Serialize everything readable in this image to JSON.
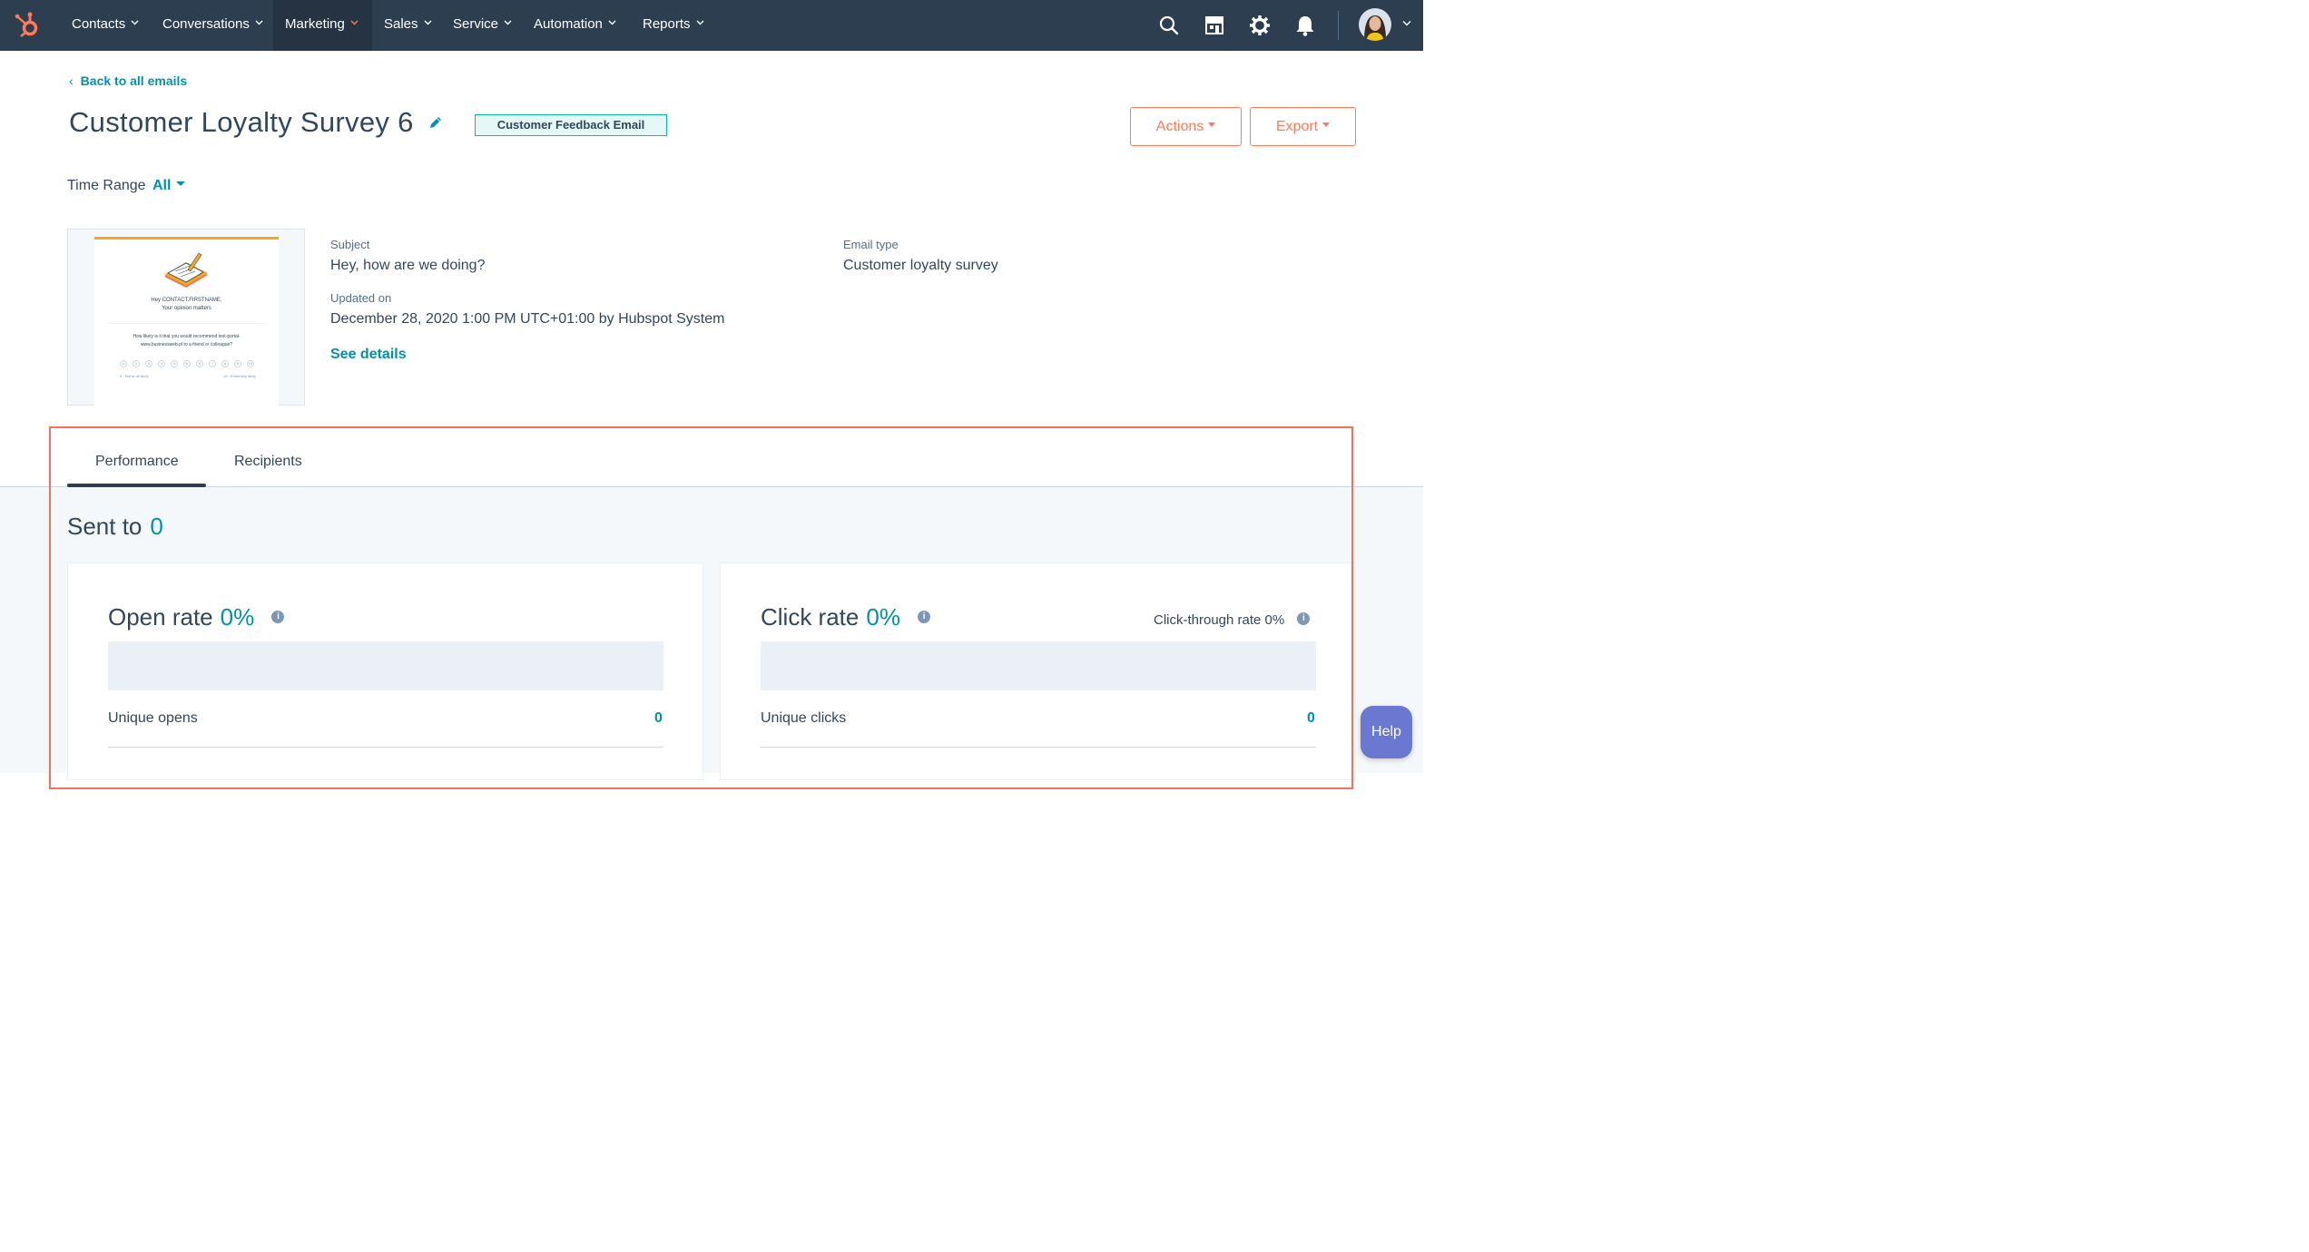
{
  "nav": {
    "items": [
      {
        "label": "Contacts"
      },
      {
        "label": "Conversations"
      },
      {
        "label": "Marketing",
        "active": true
      },
      {
        "label": "Sales"
      },
      {
        "label": "Service"
      },
      {
        "label": "Automation"
      },
      {
        "label": "Reports"
      }
    ],
    "icons": [
      "search-icon",
      "marketplace-icon",
      "gear-icon",
      "bell-icon"
    ]
  },
  "header": {
    "back_label": "Back to all emails",
    "title": "Customer Loyalty Survey 6",
    "tag": "Customer Feedback Email",
    "actions_label": "Actions",
    "export_label": "Export"
  },
  "time_range": {
    "label": "Time Range",
    "value": "All"
  },
  "preview": {
    "greeting": "Hey CONTACT.FIRSTNAME,",
    "tagline": "Your opinion matters",
    "question_line1": "How likely is it that you would recommend test-portal-",
    "question_line2": "www.businessweb.pl to a friend or colleague?",
    "scale": [
      "0",
      "1",
      "2",
      "3",
      "4",
      "5",
      "6",
      "7",
      "8",
      "9",
      "10"
    ],
    "low_label": "0 - Not at all likely",
    "high_label": "10 - Extremely likely"
  },
  "meta": {
    "subject_label": "Subject",
    "subject_value": "Hey, how are we doing?",
    "updated_label": "Updated on",
    "updated_value": "December 28, 2020 1:00 PM UTC+01:00 by Hubspot System",
    "email_type_label": "Email type",
    "email_type_value": "Customer loyalty survey",
    "see_details": "See details"
  },
  "tabs": [
    {
      "label": "Performance",
      "active": true
    },
    {
      "label": "Recipients"
    }
  ],
  "sent_to": {
    "label": "Sent to",
    "value": "0"
  },
  "open_card": {
    "title": "Open rate",
    "rate": "0%",
    "row_label": "Unique opens",
    "row_value": "0"
  },
  "click_card": {
    "title": "Click rate",
    "rate": "0%",
    "ctr_label": "Click-through rate 0%",
    "row_label": "Unique clicks",
    "row_value": "0"
  },
  "help_label": "Help",
  "colors": {
    "nav_bg": "#2d3e50",
    "accent_orange": "#ff7a59",
    "link_blue": "#0091ae",
    "badge_teal": "#00bda5",
    "highlight": "#f2735a",
    "help_purple": "#6a78d1"
  }
}
